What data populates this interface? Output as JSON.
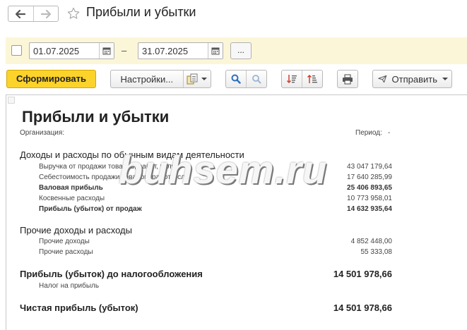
{
  "window": {
    "title": "Прибыли и убытки"
  },
  "period": {
    "date_from": "01.07.2025",
    "date_to": "31.07.2025",
    "separator": "–",
    "more_label": "..."
  },
  "toolbar": {
    "generate_label": "Сформировать",
    "settings_label": "Настройки...",
    "send_label": "Отправить"
  },
  "report": {
    "title": "Прибыли и убытки",
    "org_label": "Организация:",
    "period_label": "Период:",
    "period_value": "-",
    "section1": {
      "title": "Доходы и расходы по обычным видам деятельности",
      "rows": [
        {
          "label": "Выручка от продажи товаров, работ, услуг",
          "value": "43 047 179,64"
        },
        {
          "label": "Себестоимость продажи товаров, работ, услуг",
          "value": "17 640 285,99"
        },
        {
          "label": "Валовая прибыль",
          "value": "25 406 893,65"
        },
        {
          "label": "Косвенные расходы",
          "value": "10 773 958,01"
        },
        {
          "label": "Прибыль (убыток) от продаж",
          "value": "14 632 935,64"
        }
      ]
    },
    "section2": {
      "title": "Прочие доходы и расходы",
      "rows": [
        {
          "label": "Прочие доходы",
          "value": "4 852 448,00"
        },
        {
          "label": "Прочие расходы",
          "value": "55 333,08"
        }
      ]
    },
    "pretax": {
      "label": "Прибыль (убыток) до налогообложения",
      "value": "14 501 978,66",
      "tax_label": "Налог на прибыль"
    },
    "net": {
      "label": "Чистая прибыль (убыток)",
      "value": "14 501 978,66"
    }
  },
  "watermark": "buhsem.ru",
  "colors": {
    "primary_button": "#fbd32a",
    "period_panel": "#fbf6d8",
    "search_icon": "#2a6fc0",
    "sort_icon_red": "#d04030"
  }
}
